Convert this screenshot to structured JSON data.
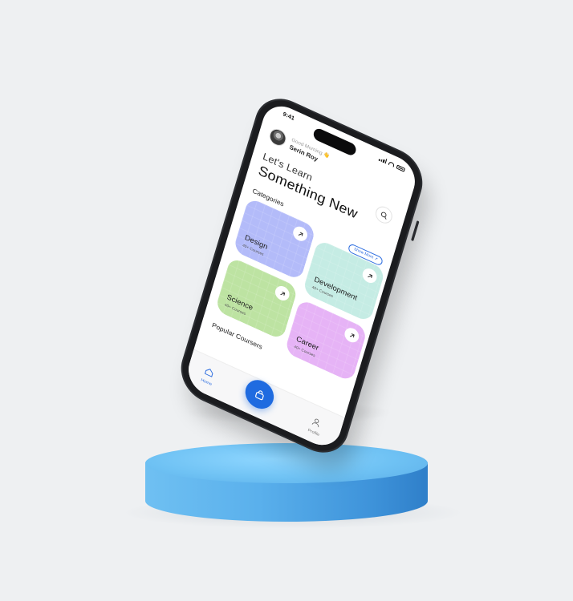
{
  "status_bar": {
    "time": "9:41"
  },
  "header": {
    "greeting": "Good Morning",
    "greeting_emoji": "👋",
    "user_name": "Serin Roy",
    "search_icon": "search-icon"
  },
  "hero": {
    "line1": "Let's Learn",
    "line2": "Something New"
  },
  "categories": {
    "heading": "Categories",
    "show_more_label": "Show More ↗",
    "items": [
      {
        "name": "Design",
        "subtitle": "40+ Courses",
        "color": "#b3bbf9"
      },
      {
        "name": "Development",
        "subtitle": "40+ Courses",
        "color": "#c5ece4"
      },
      {
        "name": "Science",
        "subtitle": "40+ Courses",
        "color": "#bde3a2"
      },
      {
        "name": "Career",
        "subtitle": "40+ Courses",
        "color": "#e6b3f6"
      }
    ]
  },
  "popular": {
    "heading": "Popular Coursers"
  },
  "nav": {
    "home_label": "Home",
    "profile_label": "Profile",
    "fab_icon": "bag-icon"
  },
  "colors": {
    "accent": "#1f6be0",
    "pedestal": "#5ab0ec",
    "background": "#eef0f2"
  }
}
